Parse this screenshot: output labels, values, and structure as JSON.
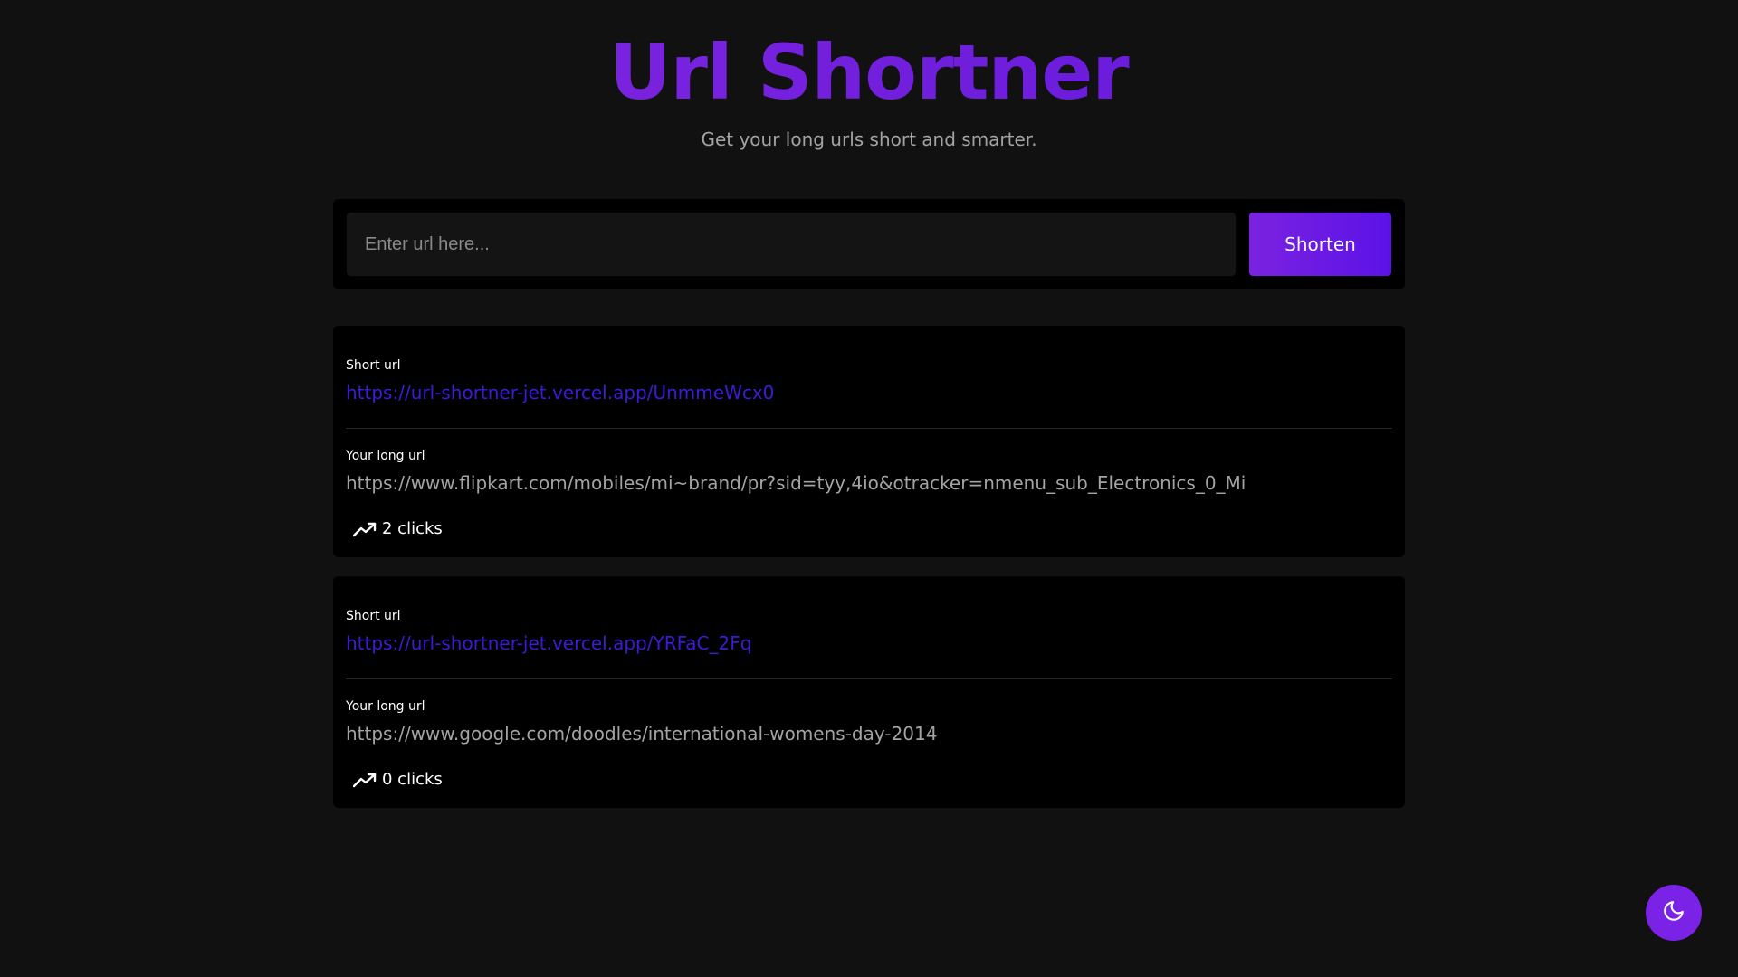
{
  "header": {
    "title": "Url Shortner",
    "subtitle": "Get your long urls short and smarter."
  },
  "form": {
    "input_placeholder": "Enter url here...",
    "input_value": "",
    "button_label": "Shorten"
  },
  "links": [
    {
      "short_label": "Short url",
      "short_url": "https://url-shortner-jet.vercel.app/UnmmeWcx0",
      "long_label": "Your long url",
      "long_url": "https://www.flipkart.com/mobiles/mi~brand/pr?sid=tyy,4io&otracker=nmenu_sub_Electronics_0_Mi",
      "clicks": "2 clicks"
    },
    {
      "short_label": "Short url",
      "short_url": "https://url-shortner-jet.vercel.app/YRFaC_2Fq",
      "long_label": "Your long url",
      "long_url": "https://www.google.com/doodles/international-womens-day-2014",
      "clicks": "0 clicks"
    }
  ],
  "icons": {
    "clicks": "trending-up-icon",
    "theme_toggle": "moon-icon"
  },
  "colors": {
    "accent": "#7b24e0",
    "link": "#3f1ad6",
    "background": "#111111",
    "panel": "#000000"
  }
}
